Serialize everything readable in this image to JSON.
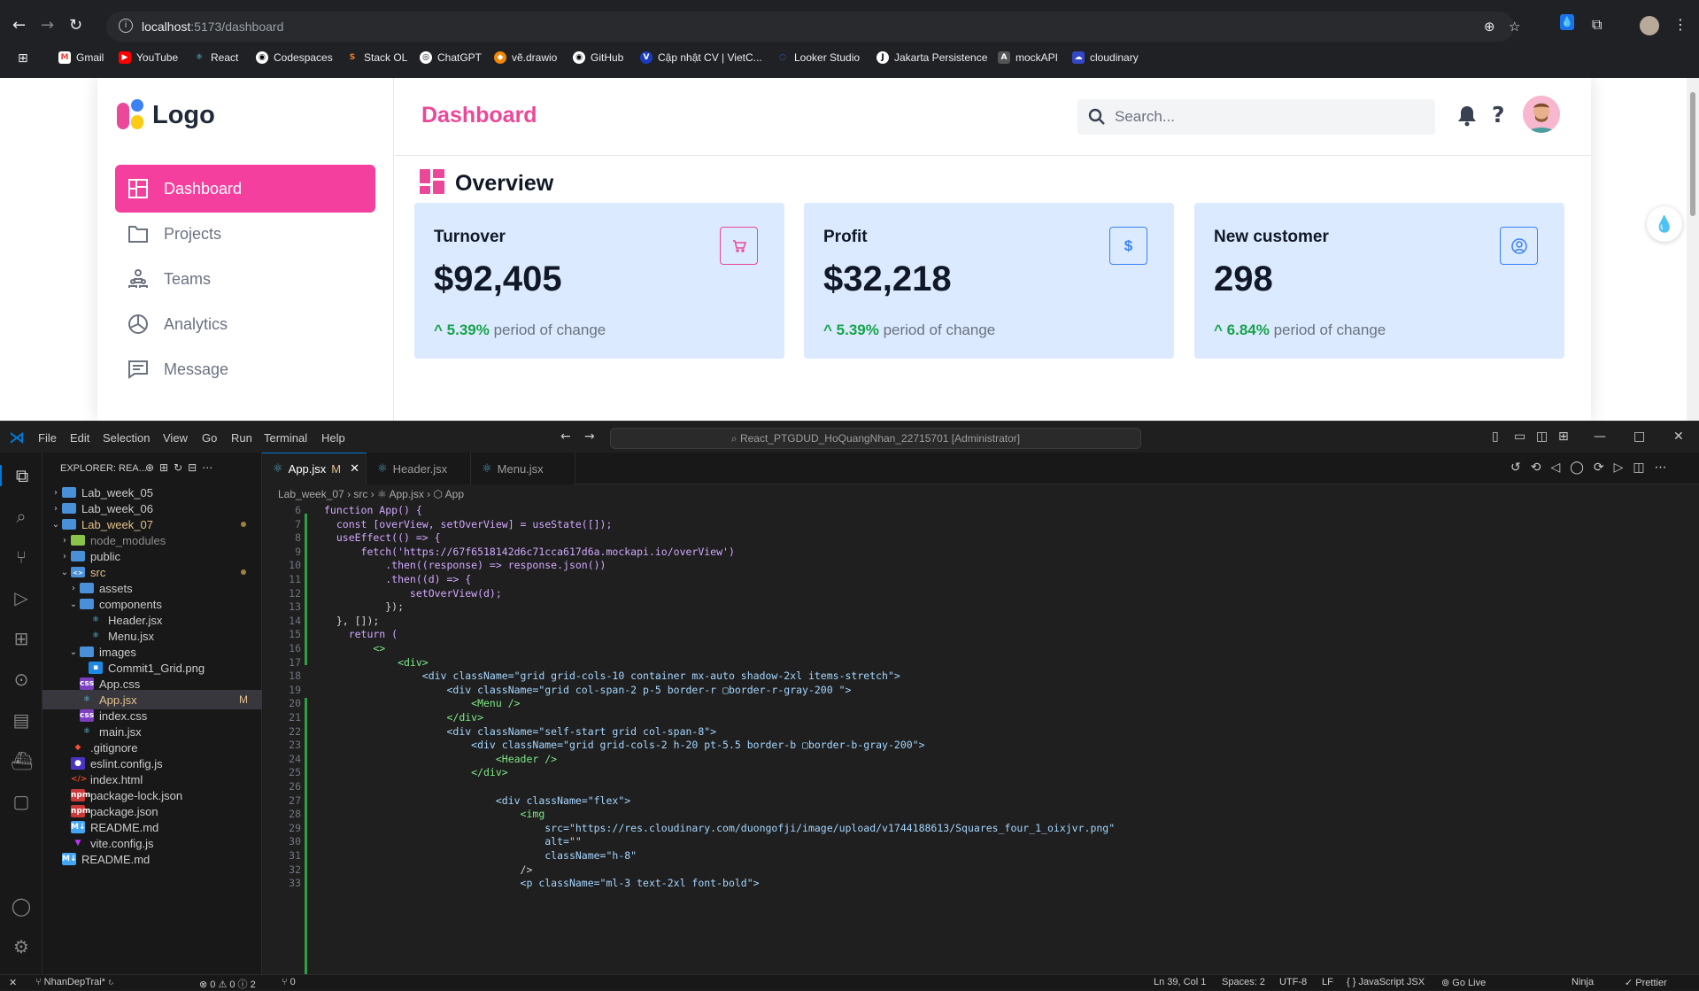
{
  "browser": {
    "url_host": "localhost",
    "url_path": ":5173/dashboard",
    "bookmarks": [
      {
        "label": "Gmail",
        "color": "#ea4335",
        "glyph": "M"
      },
      {
        "label": "YouTube",
        "color": "#ff0000",
        "glyph": "▶"
      },
      {
        "label": "React",
        "color": "#61dafb",
        "glyph": "⚛"
      },
      {
        "label": "Codespaces",
        "color": "#444",
        "glyph": "◉"
      },
      {
        "label": "Stack OL",
        "color": "#f48024",
        "glyph": "S"
      },
      {
        "label": "ChatGPT",
        "color": "#444",
        "glyph": "◎"
      },
      {
        "label": "vẽ.drawio",
        "color": "#f08705",
        "glyph": "◆"
      },
      {
        "label": "GitHub",
        "color": "#444",
        "glyph": "◉"
      },
      {
        "label": "Cập nhật CV | VietC...",
        "color": "#1a3dbf",
        "glyph": "V"
      },
      {
        "label": "Looker Studio",
        "color": "#4285f4",
        "glyph": "◌"
      },
      {
        "label": "Jakarta Persistence",
        "color": "#444",
        "glyph": "J"
      },
      {
        "label": "mockAPI",
        "color": "#555",
        "glyph": "A"
      },
      {
        "label": "cloudinary",
        "color": "#3448c5",
        "glyph": "☁"
      }
    ]
  },
  "app": {
    "logo_text": "Logo",
    "title": "Dashboard",
    "search_placeholder": "Search...",
    "menu": [
      {
        "label": "Dashboard",
        "icon": "dashboard-icon",
        "active": true
      },
      {
        "label": "Projects",
        "icon": "folder-icon",
        "active": false
      },
      {
        "label": "Teams",
        "icon": "teams-icon",
        "active": false
      },
      {
        "label": "Analytics",
        "icon": "pie-chart-icon",
        "active": false
      },
      {
        "label": "Message",
        "icon": "message-icon",
        "active": false
      }
    ],
    "overview_title": "Overview",
    "cards": [
      {
        "title": "Turnover",
        "value": "$92,405",
        "change": "^ 5.39%",
        "change_text": " period of change",
        "icon": "cart-icon",
        "accent": "#ec4899"
      },
      {
        "title": "Profit",
        "value": "$32,218",
        "change": "^ 5.39%",
        "change_text": " period of change",
        "icon": "dollar-icon",
        "accent": "#3b82f6"
      },
      {
        "title": "New customer",
        "value": "298",
        "change": "^ 6.84%",
        "change_text": " period of change",
        "icon": "user-circle-icon",
        "accent": "#3b82f6"
      }
    ]
  },
  "vscode": {
    "menus": [
      "File",
      "Edit",
      "Selection",
      "View",
      "Go",
      "Run",
      "Terminal",
      "Help"
    ],
    "command_center": "React_PTGDUD_HoQuangNhan_22715701 [Administrator]",
    "explorer_header": "EXPLORER: REA...",
    "tree": [
      {
        "label": "Lab_week_05",
        "depth": 0,
        "kind": "folder",
        "open": false
      },
      {
        "label": "Lab_week_06",
        "depth": 0,
        "kind": "folder",
        "open": false
      },
      {
        "label": "Lab_week_07",
        "depth": 0,
        "kind": "folder",
        "open": true,
        "dot": true
      },
      {
        "label": "node_modules",
        "depth": 1,
        "kind": "folder-node",
        "open": false
      },
      {
        "label": "public",
        "depth": 1,
        "kind": "folder",
        "open": false
      },
      {
        "label": "src",
        "depth": 1,
        "kind": "folder-src",
        "open": true,
        "dot": true
      },
      {
        "label": "assets",
        "depth": 2,
        "kind": "folder",
        "open": false
      },
      {
        "label": "components",
        "depth": 2,
        "kind": "folder",
        "open": true
      },
      {
        "label": "Header.jsx",
        "depth": 3,
        "kind": "react"
      },
      {
        "label": "Menu.jsx",
        "depth": 3,
        "kind": "react"
      },
      {
        "label": "images",
        "depth": 2,
        "kind": "folder-img",
        "open": true
      },
      {
        "label": "Commit1_Grid.png",
        "depth": 3,
        "kind": "image"
      },
      {
        "label": "App.css",
        "depth": 2,
        "kind": "css"
      },
      {
        "label": "App.jsx",
        "depth": 2,
        "kind": "react",
        "selected": true,
        "badge": "M"
      },
      {
        "label": "index.css",
        "depth": 2,
        "kind": "css"
      },
      {
        "label": "main.jsx",
        "depth": 2,
        "kind": "react"
      },
      {
        "label": ".gitignore",
        "depth": 1,
        "kind": "git"
      },
      {
        "label": "eslint.config.js",
        "depth": 1,
        "kind": "eslint"
      },
      {
        "label": "index.html",
        "depth": 1,
        "kind": "html"
      },
      {
        "label": "package-lock.json",
        "depth": 1,
        "kind": "npm"
      },
      {
        "label": "package.json",
        "depth": 1,
        "kind": "npm"
      },
      {
        "label": "README.md",
        "depth": 1,
        "kind": "md"
      },
      {
        "label": "vite.config.js",
        "depth": 1,
        "kind": "vite"
      },
      {
        "label": "README.md",
        "depth": 0,
        "kind": "md"
      }
    ],
    "tabs": [
      {
        "label": "App.jsx",
        "modified": "M",
        "active": true
      },
      {
        "label": "Header.jsx",
        "modified": "",
        "active": false
      },
      {
        "label": "Menu.jsx",
        "modified": "",
        "active": false
      }
    ],
    "breadcrumbs": "Lab_week_07  ›  src  ›  ⚛ App.jsx  ›  ⬡ App",
    "code": [
      {
        "n": "6",
        "t": "function App() {"
      },
      {
        "n": "7",
        "t": "  const [overView, setOverView] = useState([]);"
      },
      {
        "n": "8",
        "t": "  useEffect(() => {"
      },
      {
        "n": "9",
        "t": "      fetch('https://67f6518142d6c71cca617d6a.mockapi.io/overView')"
      },
      {
        "n": "10",
        "t": "          .then((response) => response.json())"
      },
      {
        "n": "11",
        "t": "          .then((d) => {"
      },
      {
        "n": "12",
        "t": "              setOverView(d);"
      },
      {
        "n": "13",
        "t": "          });"
      },
      {
        "n": "14",
        "t": "  }, []);"
      },
      {
        "n": "15",
        "t": "    return ("
      },
      {
        "n": "16",
        "t": "        <>"
      },
      {
        "n": "17",
        "t": "            <div>"
      },
      {
        "n": "18",
        "t": "                <div className=\"grid grid-cols-10 container mx-auto shadow-2xl items-stretch\">"
      },
      {
        "n": "19",
        "t": "                    <div className=\"grid col-span-2 p-5 border-r ▢border-r-gray-200 \">"
      },
      {
        "n": "20",
        "t": "                        <Menu />"
      },
      {
        "n": "21",
        "t": "                    </div>"
      },
      {
        "n": "22",
        "t": "                    <div className=\"self-start grid col-span-8\">"
      },
      {
        "n": "23",
        "t": "                        <div className=\"grid grid-cols-2 h-20 pt-5.5 border-b ▢border-b-gray-200\">"
      },
      {
        "n": "24",
        "t": "                            <Header />"
      },
      {
        "n": "25",
        "t": "                        </div>"
      },
      {
        "n": "26",
        "t": ""
      },
      {
        "n": "27",
        "t": "                            <div className=\"flex\">"
      },
      {
        "n": "28",
        "t": "                                <img"
      },
      {
        "n": "29",
        "t": "                                    src=\"https://res.cloudinary.com/duongofji/image/upload/v1744188613/Squares_four_1_oixjvr.png\""
      },
      {
        "n": "30",
        "t": "                                    alt=\"\""
      },
      {
        "n": "31",
        "t": "                                    className=\"h-8\""
      },
      {
        "n": "32",
        "t": "                                />"
      },
      {
        "n": "33",
        "t": "                                <p className=\"ml-3 text-2xl font-bold\">"
      }
    ],
    "status": {
      "branch": "NhanDepTrai*",
      "problems": "⊗ 0 ⚠ 0 ⓘ 2",
      "ports": "⑂ 0",
      "position": "Ln 39, Col 1",
      "spaces": "Spaces: 2",
      "encoding": "UTF-8",
      "eol": "LF",
      "language": "{ } JavaScript JSX",
      "golive": "⊚ Go Live",
      "ninja": "Ninja",
      "prettier": "✓ Prettier"
    }
  }
}
